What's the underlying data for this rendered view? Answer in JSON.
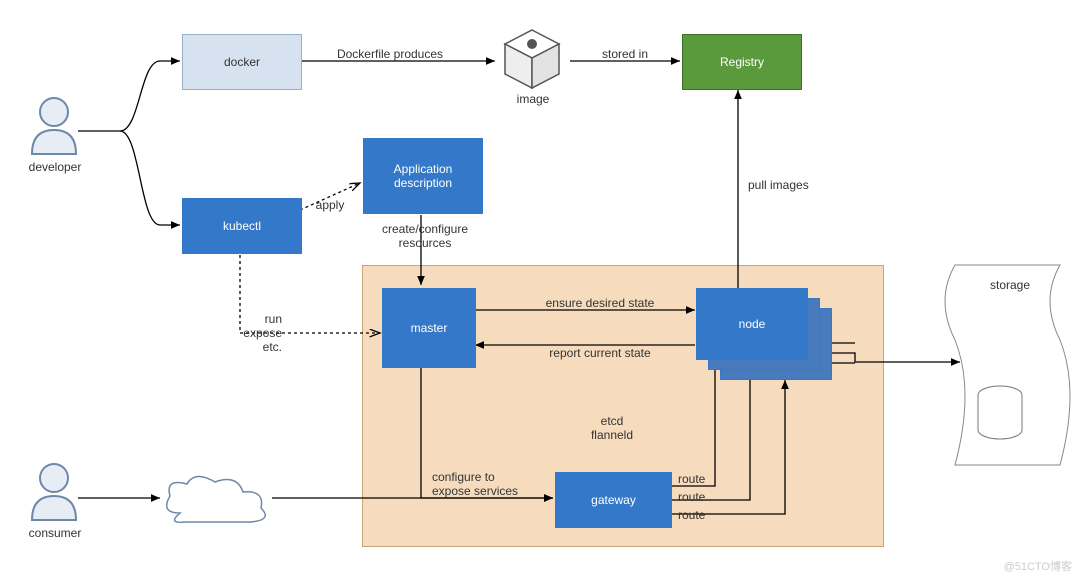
{
  "actors": {
    "developer": "developer",
    "consumer": "consumer"
  },
  "boxes": {
    "docker": "docker",
    "kubectl": "kubectl",
    "appdesc": "Application\ndescription",
    "master": "master",
    "gateway": "gateway",
    "node": "node",
    "registry": "Registry"
  },
  "edges": {
    "dockerfile": "Dockerfile produces",
    "stored_in": "stored in",
    "apply": "apply",
    "create_cfg": "create/configure\nresources",
    "run_expose": "run\nexpose\netc.",
    "ensure": "ensure desired state",
    "report": "report current state",
    "pull": "pull images",
    "configure_expose": "configure to\nexpose services",
    "route": "route"
  },
  "cluster_labels": {
    "etcd": "etcd\nflanneld"
  },
  "misc": {
    "image": "image",
    "storage": "storage"
  },
  "watermark": "@51CTO博客"
}
